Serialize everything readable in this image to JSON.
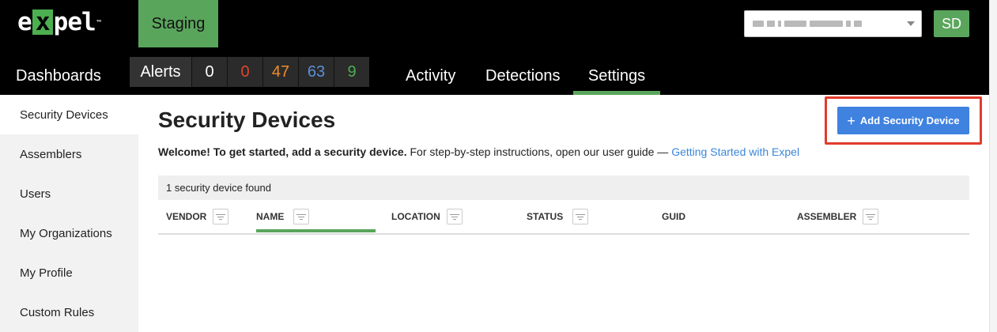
{
  "brand": {
    "logo_left": "e",
    "logo_x": "x",
    "logo_right": "pel",
    "logo_tm": "™"
  },
  "environment": "Staging",
  "user": {
    "initials": "SD"
  },
  "nav": {
    "dashboards": "Dashboards",
    "alerts": {
      "label": "Alerts",
      "counts": [
        {
          "value": "0",
          "color": "#ffffff"
        },
        {
          "value": "0",
          "color": "#e0452f"
        },
        {
          "value": "47",
          "color": "#f08c2b"
        },
        {
          "value": "63",
          "color": "#5b8fd6"
        },
        {
          "value": "9",
          "color": "#4caf50"
        }
      ]
    },
    "activity": "Activity",
    "detections": "Detections",
    "settings": "Settings"
  },
  "sidebar": {
    "items": [
      {
        "label": "Security Devices",
        "active": true
      },
      {
        "label": "Assemblers"
      },
      {
        "label": "Users"
      },
      {
        "label": "My Organizations"
      },
      {
        "label": "My Profile"
      },
      {
        "label": "Custom Rules"
      }
    ]
  },
  "main": {
    "title": "Security Devices",
    "welcome_bold": "Welcome! To get started, add a security device.",
    "welcome_text": " For step-by-step instructions, open our user guide — ",
    "welcome_link": "Getting Started with Expel",
    "add_button": "Add Security Device",
    "found_text": "1 security device found",
    "columns": [
      "VENDOR",
      "NAME",
      "LOCATION",
      "STATUS",
      "GUID",
      "ASSEMBLER"
    ]
  },
  "colors": {
    "accent_green": "#5aa55c",
    "primary_blue": "#3f82e0",
    "highlight_red": "#e13b2b"
  }
}
